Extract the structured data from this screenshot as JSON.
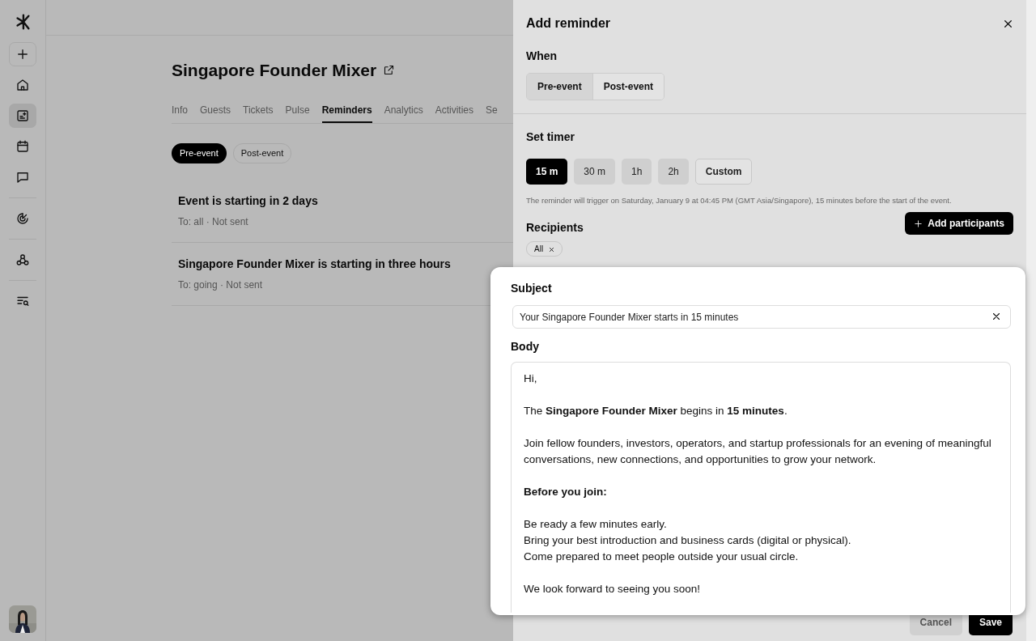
{
  "sidebar": {
    "items": [
      {
        "kind": "add",
        "selected": false
      },
      {
        "kind": "home",
        "selected": false
      },
      {
        "kind": "events",
        "selected": true
      },
      {
        "kind": "calendar",
        "selected": false
      },
      {
        "kind": "chat",
        "selected": false,
        "divider_after": true
      },
      {
        "kind": "analytics",
        "selected": false,
        "divider_after": true
      },
      {
        "kind": "integrations",
        "selected": false,
        "divider_after": true
      },
      {
        "kind": "search-list",
        "selected": false
      }
    ]
  },
  "event": {
    "title": "Singapore Founder Mixer",
    "tabs": [
      {
        "label": "Info",
        "selected": false
      },
      {
        "label": "Guests",
        "selected": false
      },
      {
        "label": "Tickets",
        "selected": false
      },
      {
        "label": "Pulse",
        "selected": false
      },
      {
        "label": "Reminders",
        "selected": true
      },
      {
        "label": "Analytics",
        "selected": false
      },
      {
        "label": "Activities",
        "selected": false
      },
      {
        "label": "Se",
        "selected": false
      }
    ],
    "filters": [
      {
        "label": "Pre-event",
        "selected": true
      },
      {
        "label": "Post-event",
        "selected": false
      }
    ],
    "reminders": [
      {
        "title": "Event is starting in 2 days",
        "meta": "To: all · Not sent"
      },
      {
        "title": "Singapore Founder Mixer is starting in three hours",
        "meta": "To: going · Not sent"
      }
    ]
  },
  "drawer": {
    "title": "Add reminder",
    "when": {
      "label": "When",
      "options": [
        {
          "label": "Pre-event",
          "selected": true
        },
        {
          "label": "Post-event",
          "selected": false
        }
      ]
    },
    "timer": {
      "label": "Set timer",
      "options": [
        {
          "label": "15 m",
          "kind": "preset",
          "selected": true
        },
        {
          "label": "30 m",
          "kind": "preset",
          "selected": false
        },
        {
          "label": "1h",
          "kind": "preset",
          "selected": false
        },
        {
          "label": "2h",
          "kind": "preset",
          "selected": false
        },
        {
          "label": "Custom",
          "kind": "custom",
          "selected": false
        }
      ],
      "hint": "The reminder will trigger on Saturday, January 9 at 04:45 PM (GMT Asia/Singapore), 15 minutes before the start of the event."
    },
    "recipients": {
      "label": "Recipients",
      "add_button": "Add participants",
      "chips": [
        "All"
      ]
    },
    "buttons": {
      "cancel": "Cancel",
      "save": "Save"
    }
  },
  "editor": {
    "subject_label": "Subject",
    "subject": "Your Singapore Founder Mixer starts in 15 minutes",
    "body_label": "Body",
    "body": [
      {
        "kind": "paragraph",
        "lines": [
          "Hi,"
        ]
      },
      {
        "kind": "paragraph",
        "lines": [
          "The **Singapore Founder Mixer** begins in **15 minutes**."
        ]
      },
      {
        "kind": "paragraph",
        "lines": [
          "Join fellow founders, investors, operators, and startup professionals for an evening of meaningful conversations, new connections, and opportunities to grow your network."
        ]
      },
      {
        "kind": "heading",
        "lines": [
          "Before you join:"
        ]
      },
      {
        "kind": "paragraph",
        "lines": [
          "Be ready a few minutes early.",
          "Bring your best introduction and business cards (digital or physical).",
          "Come prepared to meet people outside your usual circle."
        ]
      },
      {
        "kind": "paragraph",
        "lines": [
          "We look forward to seeing you soon!"
        ]
      }
    ]
  }
}
